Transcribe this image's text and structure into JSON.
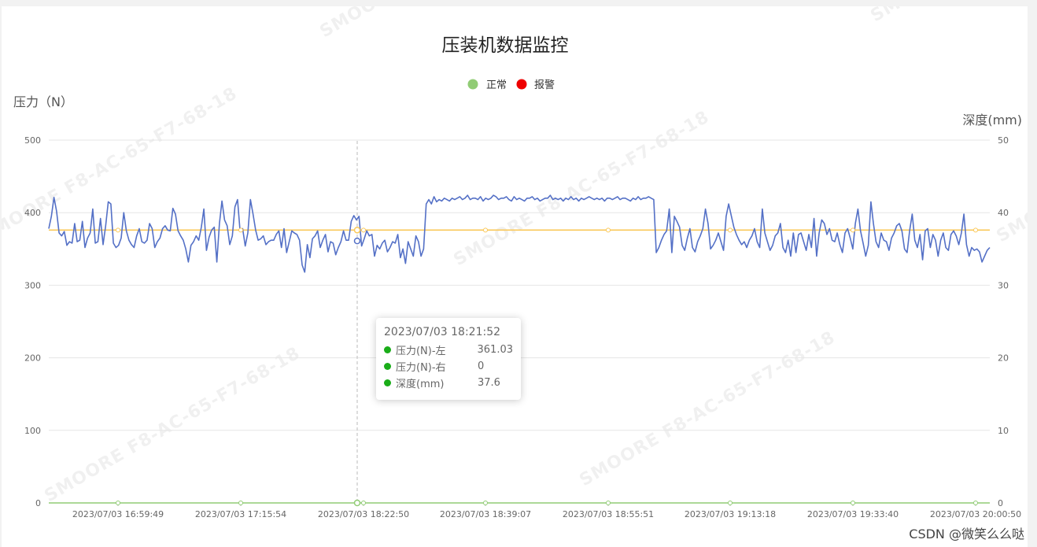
{
  "chart_data": {
    "type": "line",
    "title": "压装机数据监控",
    "legend": {
      "position": "top-center",
      "items": [
        {
          "label": "正常",
          "color": "#91cc75"
        },
        {
          "label": "报警",
          "color": "#ee0000"
        }
      ]
    },
    "y_left": {
      "name": "压力（N）",
      "min": 0,
      "max": 500,
      "ticks": [
        0,
        100,
        200,
        300,
        400,
        500
      ]
    },
    "y_right": {
      "name": "深度(mm)",
      "min": 0,
      "max": 50,
      "ticks": [
        0,
        10,
        20,
        30,
        40,
        50
      ]
    },
    "x_labels": [
      "2023/07/03 16:59:49",
      "2023/07/03 17:15:54",
      "2023/07/03 18:22:50",
      "2023/07/03 18:39:07",
      "2023/07/03 18:55:51",
      "2023/07/03 19:13:18",
      "2023/07/03 19:33:40",
      "2023/07/03 20:00:50"
    ],
    "grid": true,
    "series": [
      {
        "name": "压力(N)-左",
        "axis": "left",
        "color": "#5470c6",
        "values": [
          378,
          395,
          421,
          402,
          372,
          368,
          374,
          355,
          360,
          358,
          385,
          360,
          362,
          388,
          352,
          365,
          372,
          405,
          358,
          360,
          392,
          356,
          382,
          415,
          412,
          358,
          352,
          355,
          365,
          400,
          375,
          362,
          356,
          352,
          368,
          378,
          360,
          358,
          362,
          385,
          378,
          352,
          360,
          365,
          378,
          382,
          376,
          375,
          406,
          398,
          375,
          368,
          362,
          350,
          332,
          355,
          360,
          368,
          362,
          380,
          405,
          348,
          366,
          376,
          380,
          332,
          385,
          416,
          390,
          382,
          356,
          368,
          408,
          418,
          375,
          378,
          354,
          372,
          418,
          398,
          376,
          362,
          364,
          368,
          356,
          360,
          362,
          362,
          370,
          375,
          352,
          378,
          345,
          360,
          375,
          372,
          370,
          362,
          328,
          318,
          356,
          338,
          364,
          368,
          375,
          352,
          362,
          370,
          346,
          360,
          358,
          342,
          352,
          360,
          375,
          362,
          362,
          388,
          396,
          390,
          395,
          354,
          364,
          375,
          368,
          370,
          340,
          355,
          350,
          358,
          362,
          346,
          352,
          360,
          358,
          370,
          338,
          350,
          330,
          360,
          350,
          340,
          368,
          360,
          340,
          350,
          412,
          418,
          412,
          422,
          415,
          418,
          416,
          420,
          418,
          416,
          420,
          418,
          420,
          422,
          418,
          420,
          424,
          418,
          420,
          420,
          418,
          422,
          416,
          420,
          418,
          420,
          424,
          422,
          418,
          420,
          420,
          422,
          418,
          416,
          422,
          418,
          420,
          418,
          416,
          420,
          420,
          422,
          418,
          420,
          416,
          418,
          420,
          420,
          424,
          418,
          420,
          418,
          420,
          416,
          420,
          418,
          422,
          418,
          420,
          416,
          420,
          418,
          420,
          422,
          420,
          418,
          420,
          418,
          420,
          416,
          420,
          420,
          418,
          420,
          422,
          418,
          420,
          420,
          418,
          416,
          420,
          418,
          422,
          418,
          420,
          420,
          422,
          420,
          418,
          345,
          352,
          362,
          370,
          375,
          405,
          345,
          395,
          388,
          380,
          355,
          348,
          365,
          378,
          352,
          346,
          360,
          368,
          378,
          405,
          385,
          350,
          355,
          362,
          372,
          360,
          348,
          395,
          412,
          396,
          380,
          370,
          362,
          356,
          360,
          352,
          362,
          368,
          378,
          360,
          352,
          405,
          372,
          360,
          348,
          355,
          368,
          372,
          385,
          352,
          345,
          362,
          340,
          372,
          345,
          370,
          372,
          360,
          348,
          370,
          352,
          392,
          340,
          372,
          390,
          385,
          370,
          378,
          362,
          360,
          372,
          356,
          345,
          372,
          378,
          365,
          350,
          385,
          405,
          375,
          358,
          340,
          355,
          415,
          385,
          360,
          352,
          372,
          362,
          360,
          348,
          365,
          372,
          382,
          385,
          375,
          350,
          345,
          375,
          398,
          362,
          352,
          370,
          335,
          375,
          378,
          352,
          370,
          362,
          340,
          362,
          372,
          352,
          348,
          370,
          375,
          368,
          356,
          372,
          398,
          356,
          340,
          352,
          348,
          350,
          346,
          332,
          340,
          348,
          352
        ]
      },
      {
        "name": "压力(N)-右",
        "axis": "left",
        "color": "#91cc75",
        "values": [
          0,
          0
        ]
      },
      {
        "name": "深度(mm)",
        "axis": "right",
        "color": "#fac858",
        "values": [
          37.6,
          37.6
        ]
      }
    ],
    "tooltip": {
      "time": "2023/07/03 18:21:52",
      "items": [
        {
          "name": "压力(N)-左",
          "value": "361.03",
          "color": "#1aad19"
        },
        {
          "name": "压力(N)-右",
          "value": "0",
          "color": "#1aad19"
        },
        {
          "name": "深度(mm)",
          "value": "37.6",
          "color": "#1aad19"
        }
      ]
    }
  },
  "watermark": "SMOORE  F8-AC-65-F7-68-18",
  "credit": "CSDN @微笑么么哒"
}
